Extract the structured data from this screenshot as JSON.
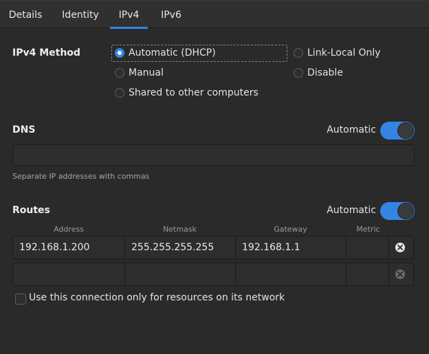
{
  "tabs": [
    {
      "label": "Details"
    },
    {
      "label": "Identity"
    },
    {
      "label": "IPv4"
    },
    {
      "label": "IPv6"
    }
  ],
  "active_tab": "IPv4",
  "ipv4_method": {
    "label": "IPv4 Method",
    "options": [
      {
        "label": "Automatic (DHCP)",
        "checked": true
      },
      {
        "label": "Link-Local Only",
        "checked": false
      },
      {
        "label": "Manual",
        "checked": false
      },
      {
        "label": "Disable",
        "checked": false
      },
      {
        "label": "Shared to other computers",
        "checked": false
      }
    ]
  },
  "dns": {
    "label": "DNS",
    "automatic_label": "Automatic",
    "automatic_on": true,
    "value": "",
    "hint": "Separate IP addresses with commas"
  },
  "routes": {
    "label": "Routes",
    "automatic_label": "Automatic",
    "automatic_on": true,
    "columns": [
      "Address",
      "Netmask",
      "Gateway",
      "Metric"
    ],
    "rows": [
      {
        "address": "192.168.1.200",
        "netmask": "255.255.255.255",
        "gateway": "192.168.1.1",
        "metric": ""
      },
      {
        "address": "",
        "netmask": "",
        "gateway": "",
        "metric": ""
      }
    ]
  },
  "only_local": {
    "label": "Use this connection only for resources on its network",
    "checked": false
  },
  "colors": {
    "accent": "#3584e4",
    "background": "#2a2a2a"
  }
}
